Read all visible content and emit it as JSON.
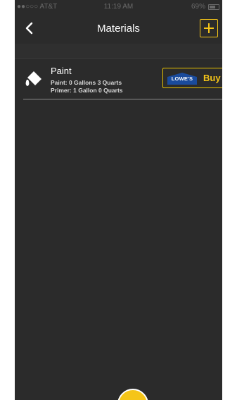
{
  "status_bar": {
    "carrier": "●●○○○ AT&T",
    "time": "11:19 AM",
    "battery_percent": "69%"
  },
  "nav": {
    "title": "Materials",
    "back_icon": "chevron-left-icon",
    "add_icon": "plus-icon"
  },
  "materials": [
    {
      "name": "Paint",
      "icon": "paint-bucket-icon",
      "paint_line": "Paint: 0 Gallons 3 Quarts",
      "primer_line": "Primer: 1 Gallon 0 Quarts",
      "store_logo": "LOWE'S",
      "buy_label": "Buy"
    }
  ],
  "colors": {
    "background": "#2b2b2b",
    "accent": "#f5c518",
    "lowes_blue": "#1a4b9c"
  }
}
